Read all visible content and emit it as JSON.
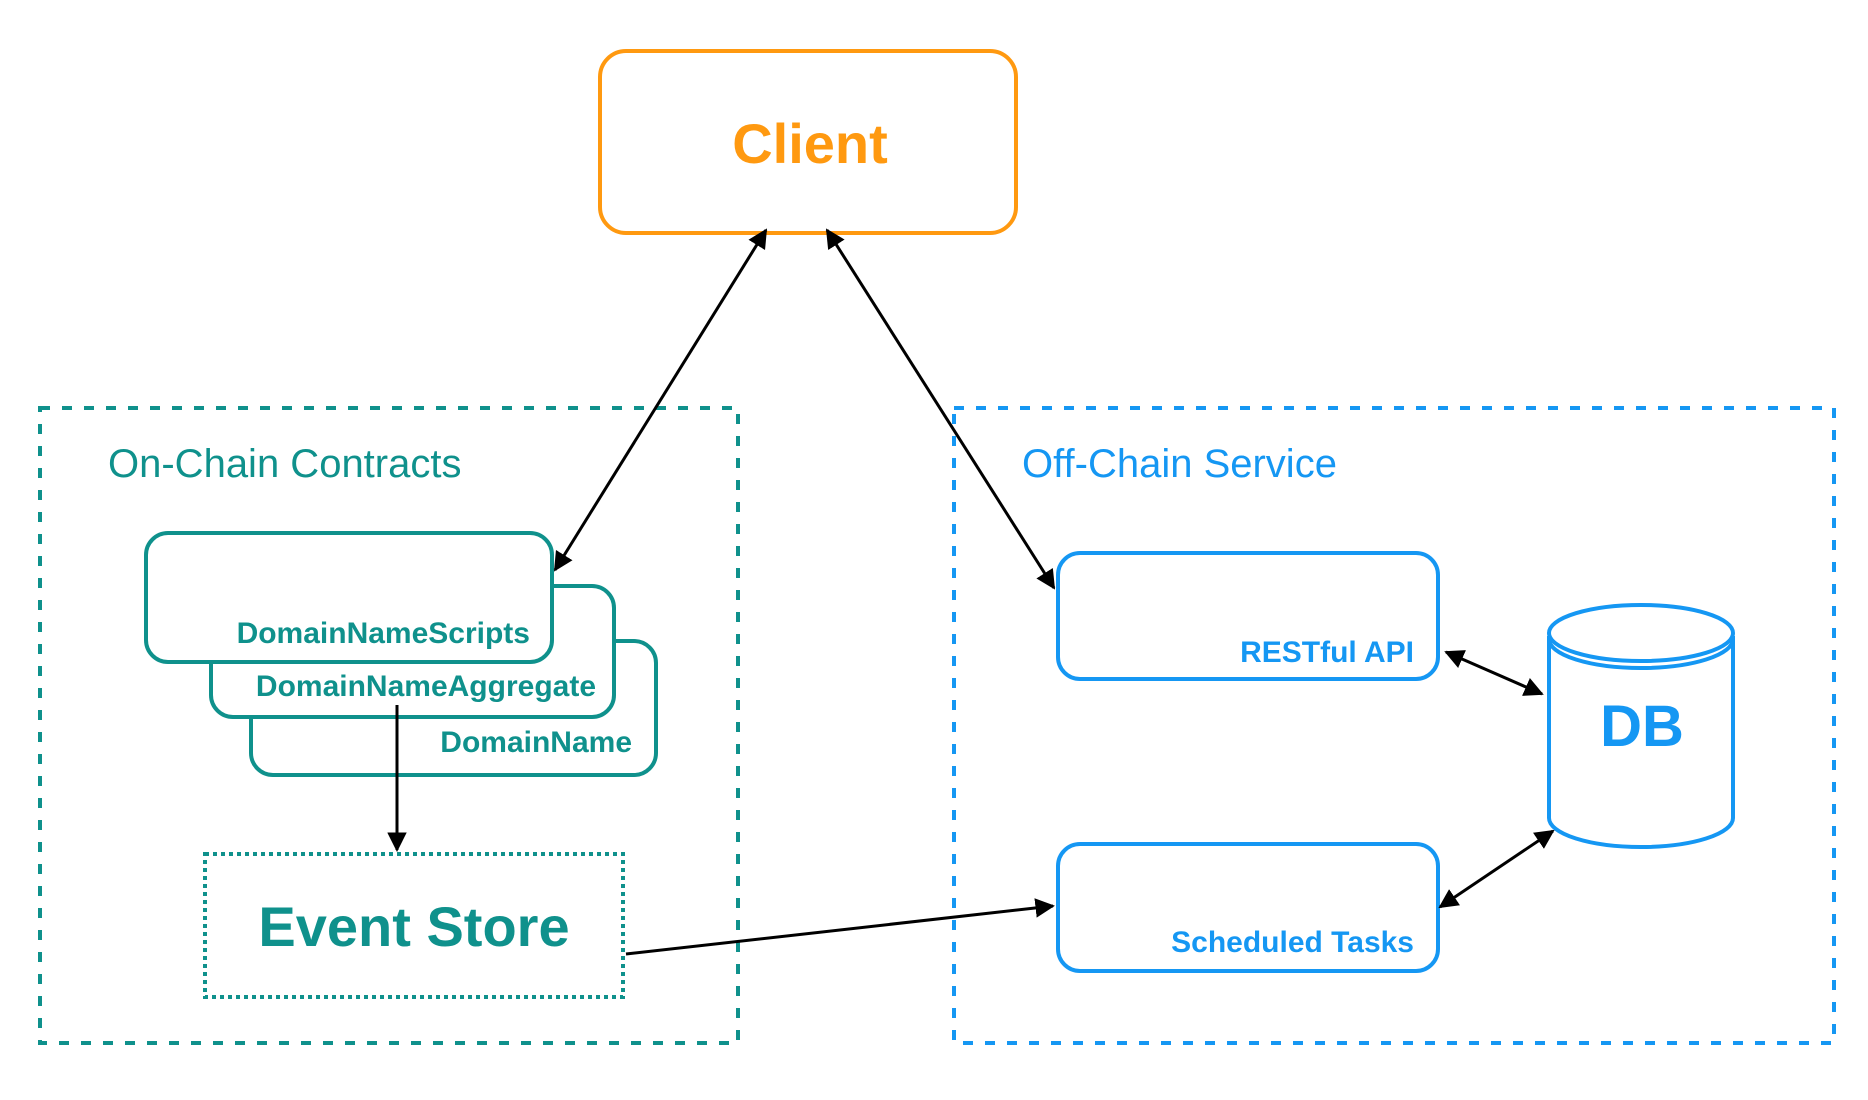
{
  "colors": {
    "client": "#FF9910",
    "on_chain": "#0F918C",
    "off_chain": "#1597F3",
    "arrow": "#000000"
  },
  "client": {
    "label": "Client"
  },
  "on_chain": {
    "title": "On-Chain Contracts",
    "contracts": [
      {
        "label": "DomainNameScripts"
      },
      {
        "label": "DomainNameAggregate"
      },
      {
        "label": "DomainName"
      }
    ],
    "event_store": {
      "label": "Event Store"
    }
  },
  "off_chain": {
    "title": "Off-Chain Service",
    "restful_api": {
      "label": "RESTful API"
    },
    "scheduled_tasks": {
      "label": "Scheduled Tasks"
    },
    "db": {
      "label": "DB"
    }
  },
  "connections": [
    {
      "from": "Client",
      "to": "DomainNameScripts",
      "direction": "bidirectional"
    },
    {
      "from": "Client",
      "to": "RESTful API",
      "direction": "bidirectional"
    },
    {
      "from": "DomainNameAggregate",
      "to": "Event Store",
      "direction": "one-way"
    },
    {
      "from": "Event Store",
      "to": "Scheduled Tasks",
      "direction": "one-way"
    },
    {
      "from": "RESTful API",
      "to": "DB",
      "direction": "bidirectional"
    },
    {
      "from": "Scheduled Tasks",
      "to": "DB",
      "direction": "bidirectional"
    }
  ]
}
